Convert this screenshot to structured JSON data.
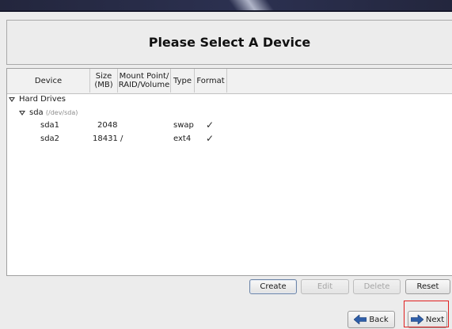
{
  "title": "Please Select A Device",
  "table": {
    "headers": {
      "device": "Device",
      "size_line1": "Size",
      "size_line2": "(MB)",
      "mount_line1": "Mount Point/",
      "mount_line2": "RAID/Volume",
      "type": "Type",
      "format": "Format"
    },
    "group": "Hard Drives",
    "drive": {
      "name": "sda",
      "path": "(/dev/sda)"
    },
    "rows": [
      {
        "device": "sda1",
        "size": "2048",
        "mount": "",
        "type": "swap",
        "format": "✓"
      },
      {
        "device": "sda2",
        "size": "18431",
        "mount": "/",
        "type": "ext4",
        "format": "✓"
      }
    ]
  },
  "actions": {
    "create": "Create",
    "edit": "Edit",
    "delete": "Delete",
    "reset": "Reset"
  },
  "nav": {
    "back": "Back",
    "next": "Next"
  },
  "colors": {
    "banner": "#2c3151",
    "arrow_icon": "#2f5ea8",
    "highlight": "#e02020"
  }
}
